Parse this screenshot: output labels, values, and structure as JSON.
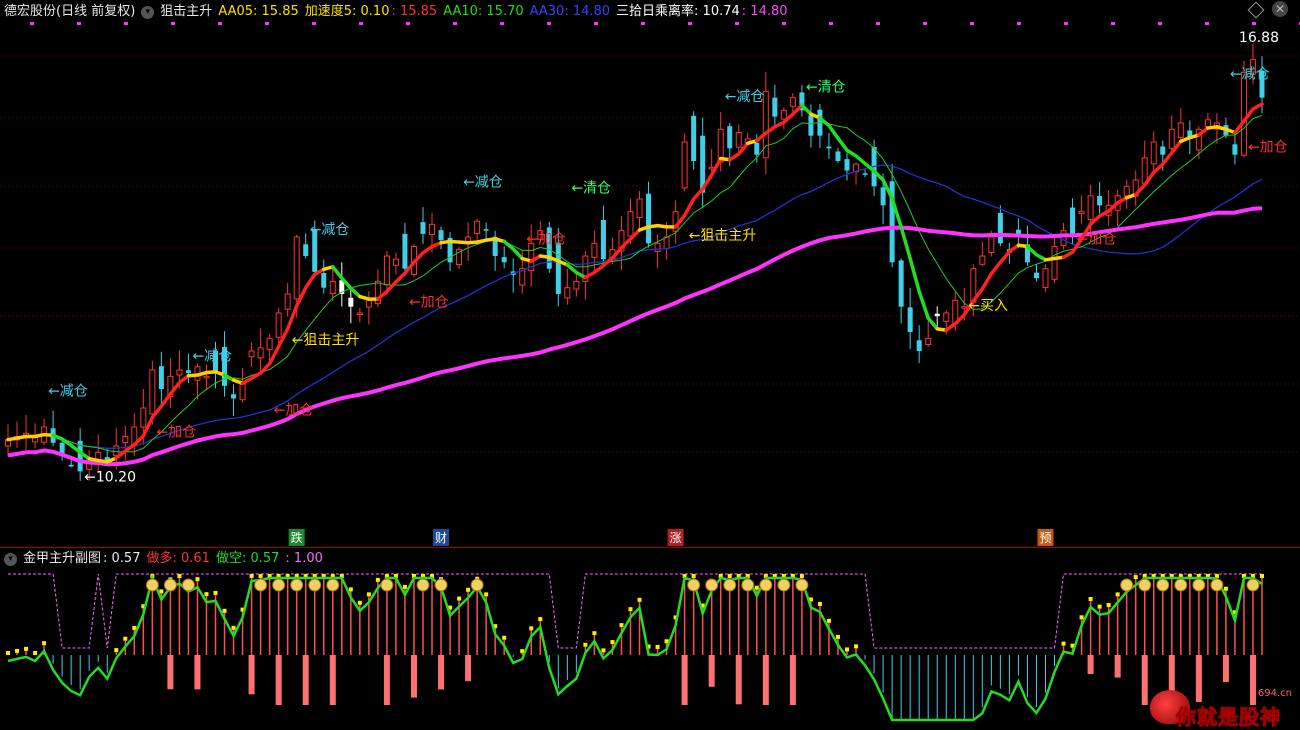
{
  "header": {
    "stock_name": "德宏股份",
    "period": "(日线 前复权)",
    "indicator_name": "狙击主升",
    "aa05": "AA05: 15.85",
    "speed_label": "加速度5: 0.10",
    "speed_val2": ": 15.85",
    "aa10": "AA10: 15.70",
    "aa30": "AA30: 14.80",
    "deviation": "三拾日乘离率: 10.74",
    "deviation2": ": 14.80"
  },
  "sub_header": {
    "title": "金甲主升副图",
    "val1": ": 0.57",
    "bull": "做多: 0.61",
    "bear": "做空: 0.57",
    "val4": ": 1.00"
  },
  "annotations": [
    {
      "text": "←减仓",
      "color": "#3fd0e8",
      "i": 4,
      "price": 11.6
    },
    {
      "text": "←加仓",
      "color": "#ff3030",
      "i": 16,
      "price": 10.95
    },
    {
      "text": "←10.20",
      "color": "#ffffff",
      "i": 8,
      "price": 10.24
    },
    {
      "text": "←减仓",
      "color": "#3fd0e8",
      "i": 20,
      "price": 12.15
    },
    {
      "text": "←加仓",
      "color": "#ff3030",
      "i": 29,
      "price": 11.3
    },
    {
      "text": "←狙击主升",
      "color": "#ffe000",
      "i": 31,
      "price": 12.4
    },
    {
      "text": "←减仓",
      "color": "#3fd0e8",
      "i": 33,
      "price": 14.15
    },
    {
      "text": "←加仓",
      "color": "#ff3030",
      "i": 44,
      "price": 13.0
    },
    {
      "text": "←减仓",
      "color": "#3fd0e8",
      "i": 50,
      "price": 14.9
    },
    {
      "text": "←加仓",
      "color": "#ff3030",
      "i": 57,
      "price": 14.0
    },
    {
      "text": "←清仓",
      "color": "#33ff66",
      "i": 62,
      "price": 14.8
    },
    {
      "text": "←狙击主升",
      "color": "#ffe000",
      "i": 75,
      "price": 14.05
    },
    {
      "text": "←减仓",
      "color": "#3fd0e8",
      "i": 79,
      "price": 16.25
    },
    {
      "text": "←清仓",
      "color": "#33ff66",
      "i": 88,
      "price": 16.4
    },
    {
      "text": "←买入",
      "color": "#ffe000",
      "i": 106,
      "price": 12.95
    },
    {
      "text": "←加仓",
      "color": "#ff3030",
      "i": 118,
      "price": 14.0
    },
    {
      "text": "←减仓",
      "color": "#3fd0e8",
      "i": 135,
      "price": 16.6
    },
    {
      "text": "←加仓",
      "color": "#ff3030",
      "i": 137,
      "price": 15.45
    },
    {
      "text": "16.88",
      "color": "#ffffff",
      "i": 136,
      "price": 17.18
    }
  ],
  "event_tags": [
    {
      "text": "跌",
      "bg": "#1a8a2a",
      "i": 32
    },
    {
      "text": "财",
      "bg": "#1a4aa0",
      "i": 48
    },
    {
      "text": "涨",
      "bg": "#b02020",
      "i": 74
    },
    {
      "text": "预",
      "bg": "#c85a10",
      "i": 115
    }
  ],
  "watermark": {
    "text": "你就是股神",
    "site": "694.cn"
  },
  "colors": {
    "up": "#ff3232",
    "down": "#3fd0e8",
    "ma5_rise": "#ff2020",
    "ma5_flat": "#ffd000",
    "ma5_fall": "#22dd22",
    "ma10": "#22cc22",
    "ma30": "#2233cc",
    "ma60": "#ff33ff"
  },
  "chart_data": {
    "type": "candlestick",
    "close": [
      10.9,
      10.95,
      11.0,
      10.95,
      11.1,
      10.85,
      10.65,
      10.5,
      10.4,
      10.6,
      10.7,
      10.55,
      10.8,
      10.95,
      11.1,
      11.4,
      12.0,
      11.7,
      11.9,
      12.0,
      11.95,
      12.05,
      11.9,
      11.95,
      11.75,
      11.55,
      11.8,
      12.3,
      12.35,
      12.5,
      12.9,
      13.2,
      14.1,
      13.8,
      13.55,
      13.3,
      13.4,
      13.2,
      13.0,
      12.9,
      13.1,
      13.4,
      13.8,
      13.75,
      13.6,
      13.95,
      14.15,
      14.3,
      14.05,
      13.7,
      13.9,
      14.1,
      14.35,
      14.2,
      13.8,
      13.7,
      13.5,
      13.6,
      14.0,
      14.2,
      13.6,
      13.2,
      13.3,
      13.4,
      13.8,
      14.0,
      13.75,
      13.9,
      14.2,
      14.5,
      14.7,
      14.0,
      14.0,
      14.1,
      14.5,
      15.6,
      15.3,
      14.8,
      15.2,
      15.8,
      15.5,
      15.75,
      15.65,
      15.4,
      16.4,
      16.0,
      16.1,
      16.3,
      16.1,
      15.7,
      15.7,
      15.5,
      15.3,
      15.15,
      15.25,
      15.1,
      14.9,
      14.6,
      13.7,
      13.0,
      12.6,
      12.3,
      12.5,
      12.85,
      12.9,
      13.1,
      13.0,
      13.6,
      13.8,
      14.1,
      14.0,
      13.85,
      14.1,
      13.7,
      13.45,
      13.6,
      13.95,
      14.2,
      14.1,
      14.5,
      14.75,
      14.6,
      14.6,
      14.75,
      14.9,
      15.0,
      15.35,
      15.6,
      15.4,
      15.8,
      15.9,
      15.65,
      15.8,
      15.95,
      15.9,
      15.7,
      15.4,
      16.7,
      16.9,
      16.3
    ],
    "ma5": 15.85,
    "speed5": 0.1,
    "ma10": 15.7,
    "ma30": 14.8,
    "bias30": 10.74,
    "bias30_b": 14.8,
    "annotated_low": 10.2,
    "annotated_high": 16.88,
    "sub_chart": {
      "name": "金甲主升副图",
      "value": 0.57,
      "bull": 0.61,
      "bear": 0.57,
      "ref": 1.0
    }
  }
}
